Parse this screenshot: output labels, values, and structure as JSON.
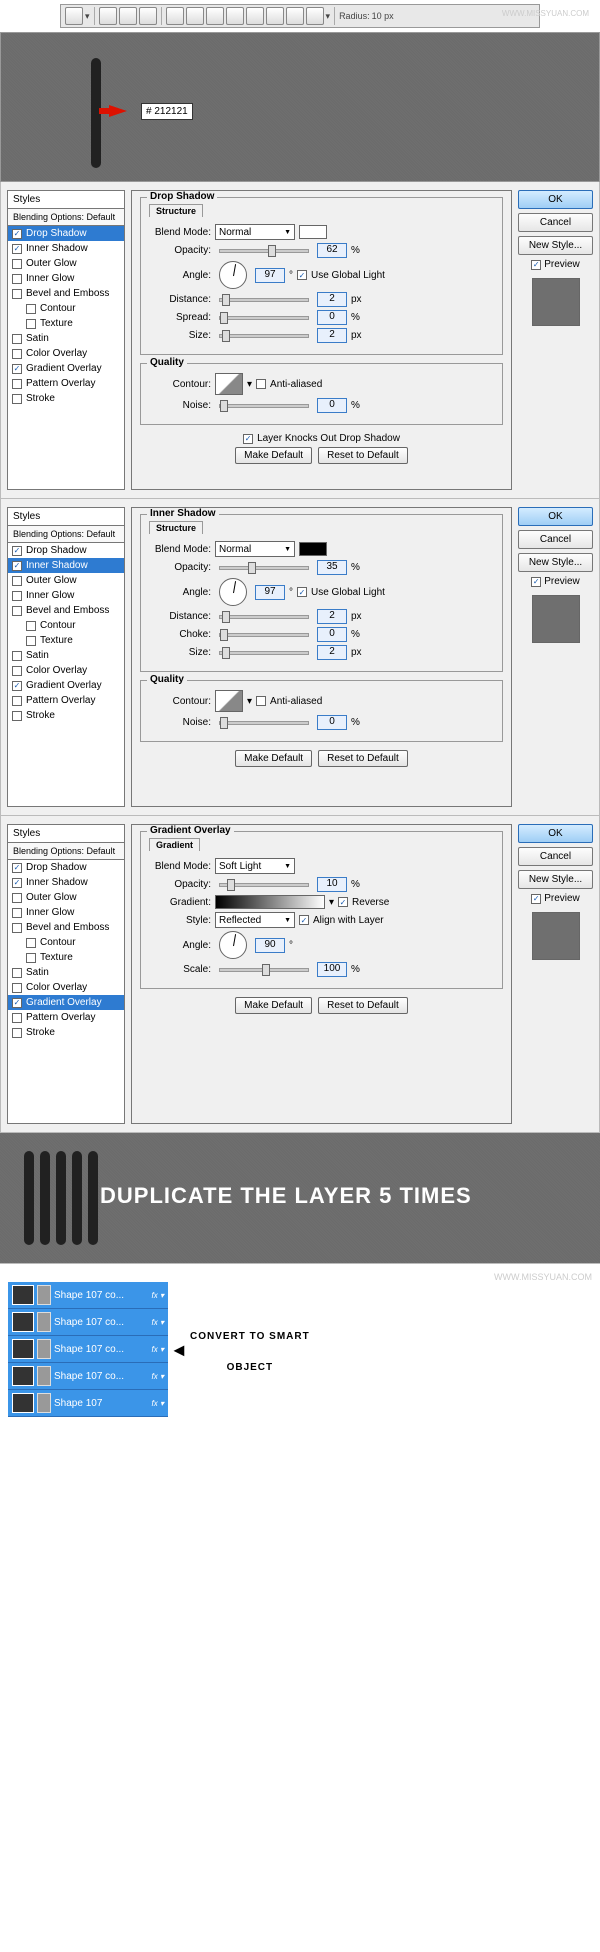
{
  "watermark": "WWW.MISSYUAN.COM",
  "toolbar": {
    "radius_label": "Radius:",
    "radius_value": "10 px"
  },
  "color_hex": "# 212121",
  "styles_tab": "Styles",
  "styles_header": "Blending Options: Default",
  "style_items": [
    {
      "label": "Drop Shadow",
      "checked": true
    },
    {
      "label": "Inner Shadow",
      "checked": true
    },
    {
      "label": "Outer Glow",
      "checked": false
    },
    {
      "label": "Inner Glow",
      "checked": false
    },
    {
      "label": "Bevel and Emboss",
      "checked": false
    },
    {
      "label": "Contour",
      "checked": false,
      "indent": true
    },
    {
      "label": "Texture",
      "checked": false,
      "indent": true
    },
    {
      "label": "Satin",
      "checked": false
    },
    {
      "label": "Color Overlay",
      "checked": false
    },
    {
      "label": "Gradient Overlay",
      "checked": true
    },
    {
      "label": "Pattern Overlay",
      "checked": false
    },
    {
      "label": "Stroke",
      "checked": false
    }
  ],
  "buttons": {
    "ok": "OK",
    "cancel": "Cancel",
    "new_style": "New Style...",
    "preview": "Preview",
    "make_default": "Make Default",
    "reset_default": "Reset to Default"
  },
  "labels": {
    "blend_mode": "Blend Mode:",
    "opacity": "Opacity:",
    "angle": "Angle:",
    "distance": "Distance:",
    "spread": "Spread:",
    "choke": "Choke:",
    "size": "Size:",
    "contour": "Contour:",
    "noise": "Noise:",
    "use_global": "Use Global Light",
    "anti": "Anti-aliased",
    "knockout": "Layer Knocks Out Drop Shadow",
    "gradient": "Gradient:",
    "style": "Style:",
    "reverse": "Reverse",
    "align": "Align with Layer",
    "scale": "Scale:"
  },
  "panel1": {
    "title": "Drop Shadow",
    "sub": "Structure",
    "quality": "Quality",
    "blend": "Normal",
    "opacity": "62",
    "angle": "97",
    "distance": "2",
    "spread": "0",
    "size": "2",
    "noise": "0"
  },
  "panel2": {
    "title": "Inner Shadow",
    "sub": "Structure",
    "quality": "Quality",
    "blend": "Normal",
    "opacity": "35",
    "angle": "97",
    "distance": "2",
    "choke": "0",
    "size": "2",
    "noise": "0"
  },
  "panel3": {
    "title": "Gradient Overlay",
    "sub": "Gradient",
    "blend": "Soft Light",
    "opacity": "10",
    "style": "Reflected",
    "angle": "90",
    "scale": "100"
  },
  "duplicate_text": "DUPLICATE THE LAYER 5 TIMES",
  "convert_text_1": "CONVERT TO SMART",
  "convert_text_2": "OBJECT",
  "layer_names": [
    "Shape 107 co...",
    "Shape 107 co...",
    "Shape 107 co...",
    "Shape 107 co...",
    "Shape 107"
  ],
  "fx": "fx"
}
